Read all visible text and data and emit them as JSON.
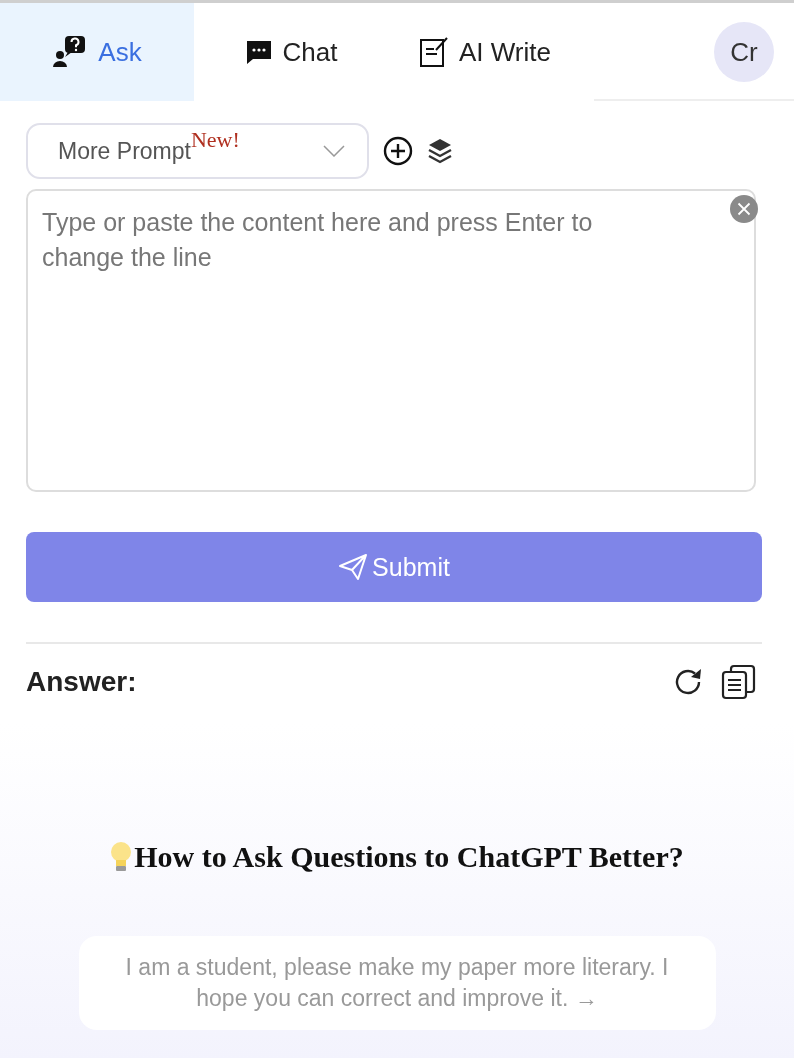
{
  "tabs": [
    {
      "label": "Ask",
      "kind": "ask",
      "selected": true
    },
    {
      "label": "Chat",
      "kind": "chat",
      "selected": false
    },
    {
      "label": "AI Write",
      "kind": "write",
      "selected": false
    }
  ],
  "avatar": "Cr",
  "prompt_select": {
    "label": "More Prompt",
    "badge": "New!"
  },
  "input": {
    "placeholder": "Type or paste the content here and press Enter to change the line"
  },
  "submit": "Submit",
  "answer": {
    "label": "Answer:"
  },
  "tips": {
    "title": "How to Ask Questions to ChatGPT Better?",
    "example": "I am a student, please make my paper more literary. I hope you can correct and improve it. →"
  }
}
